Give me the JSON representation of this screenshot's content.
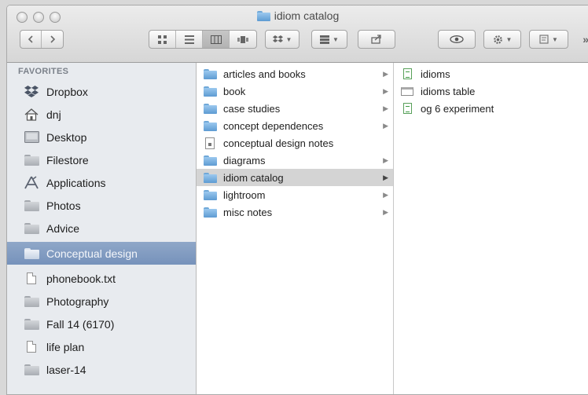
{
  "window": {
    "title": "idiom catalog"
  },
  "sidebar": {
    "header": "FAVORITES",
    "items": [
      {
        "label": "Dropbox",
        "icon": "dropbox-icon"
      },
      {
        "label": "dnj",
        "icon": "home-icon"
      },
      {
        "label": "Desktop",
        "icon": "desktop-icon"
      },
      {
        "label": "Filestore",
        "icon": "folder-icon"
      },
      {
        "label": "Applications",
        "icon": "applications-icon"
      },
      {
        "label": "Photos",
        "icon": "folder-icon"
      },
      {
        "label": "Advice",
        "icon": "folder-icon"
      },
      {
        "label": "Conceptual design",
        "icon": "folder-icon",
        "selected": true
      },
      {
        "label": "phonebook.txt",
        "icon": "document-icon"
      },
      {
        "label": "Photography",
        "icon": "folder-icon"
      },
      {
        "label": "Fall 14 (6170)",
        "icon": "folder-icon"
      },
      {
        "label": "life plan",
        "icon": "document-icon"
      },
      {
        "label": "laser-14",
        "icon": "folder-icon"
      }
    ]
  },
  "column1": {
    "items": [
      {
        "label": "articles and books",
        "icon": "folder-icon",
        "has_children": true
      },
      {
        "label": "book",
        "icon": "folder-icon",
        "has_children": true
      },
      {
        "label": "case studies",
        "icon": "folder-icon",
        "has_children": true
      },
      {
        "label": "concept dependences",
        "icon": "folder-icon",
        "has_children": true
      },
      {
        "label": "conceptual design notes",
        "icon": "notes-document-icon",
        "has_children": false
      },
      {
        "label": "diagrams",
        "icon": "folder-icon",
        "has_children": true
      },
      {
        "label": "idiom catalog",
        "icon": "folder-icon",
        "has_children": true,
        "selected": true
      },
      {
        "label": "lightroom",
        "icon": "folder-icon",
        "has_children": true
      },
      {
        "label": "misc notes",
        "icon": "folder-icon",
        "has_children": true
      }
    ]
  },
  "column2": {
    "items": [
      {
        "label": "idioms",
        "icon": "spreadsheet-icon"
      },
      {
        "label": "idioms table",
        "icon": "table-document-icon"
      },
      {
        "label": "og 6 experiment",
        "icon": "spreadsheet-icon"
      }
    ]
  },
  "toolbar": {
    "overflow": "»"
  }
}
